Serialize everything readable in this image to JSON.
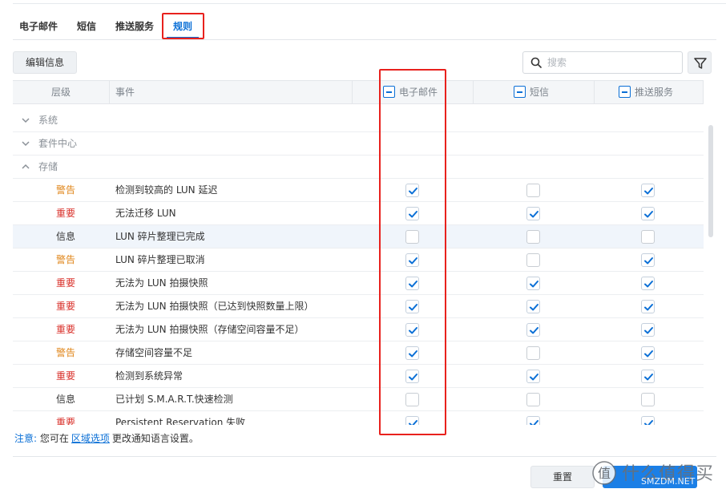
{
  "tabs": [
    {
      "label": "电子邮件",
      "active": false
    },
    {
      "label": "短信",
      "active": false
    },
    {
      "label": "推送服务",
      "active": false
    },
    {
      "label": "规则",
      "active": true
    }
  ],
  "toolbar": {
    "edit_label": "编辑信息",
    "search_placeholder": "搜索"
  },
  "table": {
    "headers": {
      "level": "层级",
      "event": "事件",
      "email": "电子邮件",
      "sms": "短信",
      "push": "推送服务"
    },
    "groups": [
      {
        "label": "系统",
        "expanded": false
      },
      {
        "label": "套件中心",
        "expanded": false
      },
      {
        "label": "存储",
        "expanded": true
      }
    ],
    "rows": [
      {
        "level": "警告",
        "level_color": "#e0861a",
        "event": "检测到较高的 LUN 延迟",
        "email": true,
        "sms": false,
        "push": true
      },
      {
        "level": "重要",
        "level_color": "#d9302a",
        "event": "无法迁移 LUN",
        "email": true,
        "sms": true,
        "push": true
      },
      {
        "level": "信息",
        "level_color": "#333333",
        "event": "LUN 碎片整理已完成",
        "email": false,
        "sms": false,
        "push": false
      },
      {
        "level": "警告",
        "level_color": "#e0861a",
        "event": "LUN 碎片整理已取消",
        "email": true,
        "sms": false,
        "push": true
      },
      {
        "level": "重要",
        "level_color": "#d9302a",
        "event": "无法为 LUN 拍摄快照",
        "email": true,
        "sms": true,
        "push": true
      },
      {
        "level": "重要",
        "level_color": "#d9302a",
        "event": "无法为 LUN 拍摄快照（已达到快照数量上限）",
        "email": true,
        "sms": true,
        "push": true
      },
      {
        "level": "重要",
        "level_color": "#d9302a",
        "event": "无法为 LUN 拍摄快照（存储空间容量不足）",
        "email": true,
        "sms": true,
        "push": true
      },
      {
        "level": "警告",
        "level_color": "#e0861a",
        "event": "存储空间容量不足",
        "email": true,
        "sms": false,
        "push": true
      },
      {
        "level": "重要",
        "level_color": "#d9302a",
        "event": "检测到系统异常",
        "email": true,
        "sms": true,
        "push": true
      },
      {
        "level": "信息",
        "level_color": "#333333",
        "event": "已计划 S.M.A.R.T.快速检测",
        "email": false,
        "sms": false,
        "push": false
      },
      {
        "level": "重要",
        "level_color": "#d9302a",
        "event": "Persistent Reservation 失败",
        "email": true,
        "sms": true,
        "push": true
      }
    ]
  },
  "note": {
    "label": "注意:",
    "prefix": "您可在",
    "link": "区域选项",
    "suffix": "更改通知语言设置。"
  },
  "footer": {
    "reset_label": "重置"
  },
  "watermark": {
    "text": "什么值得买",
    "sub": "SMZDM.NET"
  },
  "colors": {
    "accent": "#0a6fd6",
    "highlight_box": "#e8211d",
    "warning": "#e0861a",
    "important": "#d9302a"
  }
}
